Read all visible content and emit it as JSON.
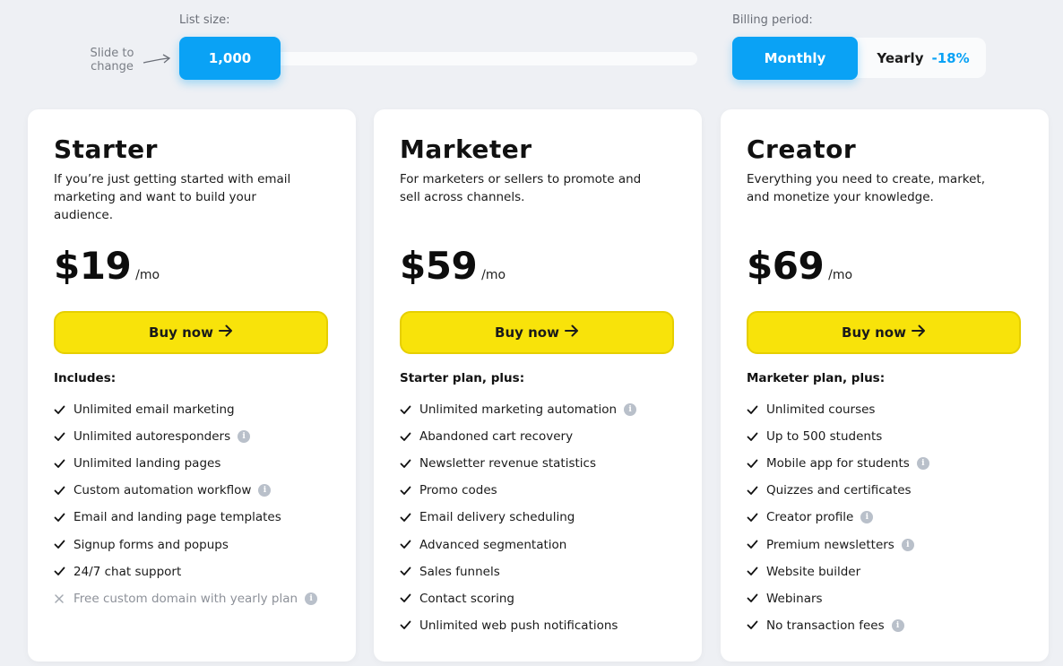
{
  "list_size": {
    "label": "List size:",
    "hint": "Slide to change",
    "value": "1,000"
  },
  "billing": {
    "label": "Billing period:",
    "monthly": "Monthly",
    "yearly": "Yearly",
    "yearly_discount": "-18%",
    "selected": "Monthly"
  },
  "colors": {
    "accent": "#0aa2f5",
    "buy_button": "#f8e30a",
    "background": "#eef0f4"
  },
  "plans": [
    {
      "name": "Starter",
      "description": "If you’re just getting started with email marketing and want to build your audience.",
      "price": "$19",
      "period": "/mo",
      "button": "Buy now",
      "features_heading": "Includes:",
      "features": [
        {
          "text": "Unlimited email marketing",
          "info": false,
          "included": true
        },
        {
          "text": "Unlimited autoresponders",
          "info": true,
          "included": true
        },
        {
          "text": "Unlimited landing pages",
          "info": false,
          "included": true
        },
        {
          "text": "Custom automation workflow",
          "info": true,
          "included": true
        },
        {
          "text": "Email and landing page templates",
          "info": false,
          "included": true
        },
        {
          "text": "Signup forms and popups",
          "info": false,
          "included": true
        },
        {
          "text": "24/7 chat support",
          "info": false,
          "included": true
        },
        {
          "text": "Free custom domain with yearly plan",
          "info": true,
          "included": false
        }
      ]
    },
    {
      "name": "Marketer",
      "description": "For marketers or sellers to promote and sell across channels.",
      "price": "$59",
      "period": "/mo",
      "button": "Buy now",
      "features_heading": "Starter plan, plus:",
      "features": [
        {
          "text": "Unlimited marketing automation",
          "info": true,
          "included": true
        },
        {
          "text": "Abandoned cart recovery",
          "info": false,
          "included": true
        },
        {
          "text": "Newsletter revenue statistics",
          "info": false,
          "included": true
        },
        {
          "text": "Promo codes",
          "info": false,
          "included": true
        },
        {
          "text": "Email delivery scheduling",
          "info": false,
          "included": true
        },
        {
          "text": "Advanced segmentation",
          "info": false,
          "included": true
        },
        {
          "text": "Sales funnels",
          "info": false,
          "included": true
        },
        {
          "text": "Contact scoring",
          "info": false,
          "included": true
        },
        {
          "text": "Unlimited web push notifications",
          "info": false,
          "included": true
        }
      ]
    },
    {
      "name": "Creator",
      "description": "Everything you need to create, market, and monetize your knowledge.",
      "price": "$69",
      "period": "/mo",
      "button": "Buy now",
      "features_heading": "Marketer plan, plus:",
      "features": [
        {
          "text": "Unlimited courses",
          "info": false,
          "included": true
        },
        {
          "text": "Up to 500 students",
          "info": false,
          "included": true
        },
        {
          "text": "Mobile app for students",
          "info": true,
          "included": true
        },
        {
          "text": "Quizzes and certificates",
          "info": false,
          "included": true
        },
        {
          "text": "Creator profile",
          "info": true,
          "included": true
        },
        {
          "text": "Premium newsletters",
          "info": true,
          "included": true
        },
        {
          "text": "Website builder",
          "info": false,
          "included": true
        },
        {
          "text": "Webinars",
          "info": false,
          "included": true
        },
        {
          "text": "No transaction fees",
          "info": true,
          "included": true
        }
      ]
    }
  ]
}
